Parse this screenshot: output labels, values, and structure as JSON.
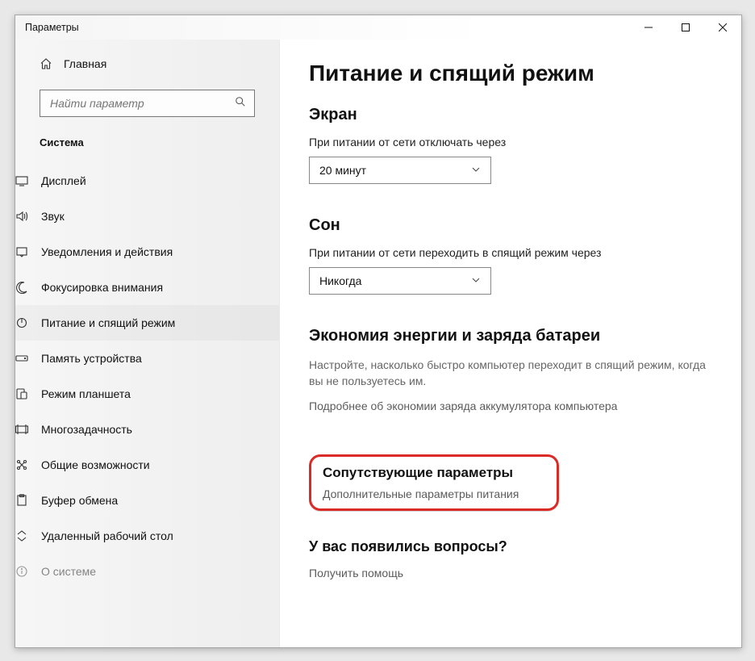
{
  "window": {
    "title": "Параметры"
  },
  "sidebar": {
    "home": "Главная",
    "search_placeholder": "Найти параметр",
    "section": "Система",
    "items": [
      {
        "label": "Дисплей"
      },
      {
        "label": "Звук"
      },
      {
        "label": "Уведомления и действия"
      },
      {
        "label": "Фокусировка внимания"
      },
      {
        "label": "Питание и спящий режим"
      },
      {
        "label": "Память устройства"
      },
      {
        "label": "Режим планшета"
      },
      {
        "label": "Многозадачность"
      },
      {
        "label": "Общие возможности"
      },
      {
        "label": "Буфер обмена"
      },
      {
        "label": "Удаленный рабочий стол"
      },
      {
        "label": "О системе"
      }
    ]
  },
  "main": {
    "title": "Питание и спящий режим",
    "screen": {
      "heading": "Экран",
      "label": "При питании от сети отключать через",
      "value": "20 минут"
    },
    "sleep": {
      "heading": "Сон",
      "label": "При питании от сети переходить в спящий режим через",
      "value": "Никогда"
    },
    "battery": {
      "heading": "Экономия энергии и заряда батареи",
      "desc": "Настройте, насколько быстро компьютер переходит в спящий режим, когда вы не пользуетесь им.",
      "link": "Подробнее об экономии заряда аккумулятора компьютера"
    },
    "related": {
      "heading": "Сопутствующие параметры",
      "link": "Дополнительные параметры питания"
    },
    "help": {
      "heading": "У вас появились вопросы?",
      "link": "Получить помощь"
    }
  }
}
